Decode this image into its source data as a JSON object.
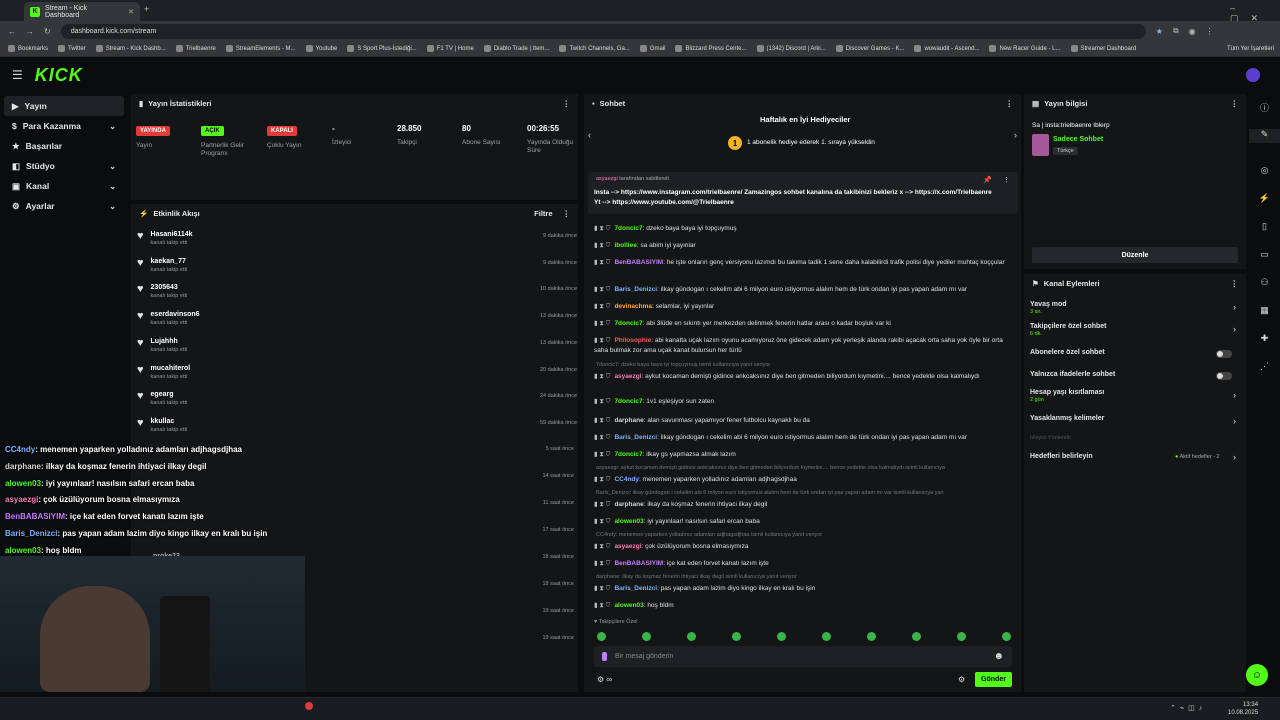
{
  "browser": {
    "tab_title": "Stream - Kick Dashboard",
    "url": "dashboard.kick.com/stream",
    "bookmarks": [
      "Bookmarks",
      "Twitter",
      "Stream - Kick Dashb...",
      "Trielbaenre",
      "StreamElements - M...",
      "Youtube",
      "S Sport Plus-İstediği...",
      "F1 TV | Home",
      "Diablo Trade | Item...",
      "Twitch Channels, Ga...",
      "Gmail",
      "Blizzard Press Cente...",
      "(1342) Discord | Arki...",
      "Discover Games - K...",
      "wowaudit - Ascend...",
      "New Racer Guide - L...",
      "Streamer Dashboard"
    ],
    "all_bookmarks": "Tüm Yer İşaretleri"
  },
  "brand": {
    "logo": "KICK"
  },
  "sidebar": {
    "items": [
      {
        "label": "Yayın"
      },
      {
        "label": "Para Kazanma"
      },
      {
        "label": "Başarılar"
      },
      {
        "label": "Stüdyo"
      },
      {
        "label": "Kanal"
      },
      {
        "label": "Ayarlar"
      }
    ]
  },
  "stats": {
    "title": "Yayın İstatistikleri",
    "cells": [
      {
        "badge": "YAYINDA",
        "label": "Yayın"
      },
      {
        "badge": "AÇIK",
        "label": "Partnerlik Gelir Programı"
      },
      {
        "badge": "KAPALI",
        "label": "Çoklu Yayın"
      },
      {
        "value": "-",
        "label": "İzleyici"
      },
      {
        "value": "28.850",
        "label": "Takipçi"
      },
      {
        "value": "80",
        "label": "Abone Sayısı"
      },
      {
        "value": "00:26:55",
        "label": "Yayında Olduğu Süre"
      }
    ]
  },
  "activity": {
    "title": "Etkinlik Akışı",
    "filter": "Filtre",
    "items": [
      {
        "name": "Hasani6114k",
        "sub": "kanalı takip etti",
        "time": "9 dakika önce"
      },
      {
        "name": "kaekan_77",
        "sub": "kanalı takip etti",
        "time": "9 dakika önce"
      },
      {
        "name": "2305643",
        "sub": "kanalı takip etti",
        "time": "10 dakika önce"
      },
      {
        "name": "eserdavinson6",
        "sub": "kanalı takip etti",
        "time": "13 dakika önce"
      },
      {
        "name": "Lujahhh",
        "sub": "kanalı takip etti",
        "time": "13 dakika önce"
      },
      {
        "name": "mucahiterol",
        "sub": "kanalı takip etti",
        "time": "20 dakika önce"
      },
      {
        "name": "egearg",
        "sub": "kanalı takip etti",
        "time": "24 dakika önce"
      },
      {
        "name": "kkullac",
        "sub": "kanalı takip etti",
        "time": "59 dakika önce"
      }
    ],
    "times_more": [
      "5 saat önce",
      "14 saat önce",
      "11 saat önce",
      "17 saat önce",
      "18 saat önce",
      "18 saat önce",
      "19 saat önce",
      "19 saat önce"
    ],
    "partial_name": "proke23"
  },
  "overlay_chat": [
    {
      "user": "CC4ndy",
      "color": "#7fb2ff",
      "text": ": menemen yaparken yolladınız adamları adjhagsdjhaa"
    },
    {
      "user": "darphane",
      "color": "#d5d5d5",
      "text": ": ilkay da koşmaz fenerin ihtiyaci ilkay degil"
    },
    {
      "user": "alowen03",
      "color": "#53fc18",
      "text": ": iyi yayınlaar! nasılsın safari ercan baba"
    },
    {
      "user": "asyaezgi",
      "color": "#ff7eb6",
      "text": ": çok üzülüyorum bosna elmasıymıza"
    },
    {
      "user": "BenBABASIYIM",
      "color": "#c67cff",
      "text": ": içe kat eden forvet kanatı lazım işte"
    },
    {
      "user": "Baris_Denizci",
      "color": "#7fb2ff",
      "text": ": pas yapan adam lazim diyo kingo ilkay en kralı bu işin"
    },
    {
      "user": "alowen03",
      "color": "#53fc18",
      "text": ": hoş bldm"
    }
  ],
  "chat": {
    "title": "Sohbet",
    "gift_title": "Haftalık en İyi Hediyeciler",
    "gift_rank": "1",
    "gift_text": "1 abonelik hediye ederek 1. sıraya yükseldin",
    "pinned_by": "asyaezgi",
    "pinned_by_suffix": "tarafından sabitlendi",
    "pinned_text": "Insta --> https://www.instagram.com/trielbaenre/ Zamazingos sohbet kanalına da takibinizi bekleriz x --> https://x.com/Trielbaenre Yt --> https://www.youtube.com/@Trielbaenre",
    "messages": [
      {
        "user": "7doncic7",
        "color": "#53fc18",
        "text": ": dzeko baya baya iyi topçuymuş"
      },
      {
        "user": "ibolliee",
        "color": "#53fc18",
        "text": ": sa abim iyi yayınlar"
      },
      {
        "user": "BenBABASIYIM",
        "color": "#c67cff",
        "text": ": he işte onların genç versiyonu lazımdı bu takıma tadik 1 sene daha kalabilirdi trafik polisi diye yediler muhtaç koççular"
      },
      {
        "user": "Baris_Denizci",
        "color": "#7fb2ff",
        "text": ": ilkay gündogan ı cekelim abi 6 milyon euro istiyormus alalım hem de türk ondan iyi pas yapan adam mı var"
      },
      {
        "user": "devinachma",
        "color": "#ffb02e",
        "text": ": selamlar, iyi yayınlar"
      },
      {
        "user": "7doncic7",
        "color": "#53fc18",
        "text": ": abi 3lüde en sıkıntı yer merkezden delinmek fenerin hatlar arası o kadar boşluk var ki"
      },
      {
        "user": "Philosophie",
        "color": "#ff5c5c",
        "text": ": abi kanatta uçak lazım oyunu acamıyoruz öne gidecek adam yok yerleşik alanda rakibi açacak orta saha yok öyle bir orta saha bulmak zor ama uçak kanat bulursun her türlü"
      },
      {
        "user": "asyaezgi",
        "color": "#ff7eb6",
        "text": ": aykut kocaman demişti gidince ankcaksınız diye ben gitmeden biliyordum kıymetini.... bence yedekte olsa kalmalıydı"
      },
      {
        "user": "7doncic7",
        "color": "#53fc18",
        "text": ": 1v1 eşleşiyor sun zaten"
      },
      {
        "user": "darphane",
        "color": "#d5d5d5",
        "text": ": alan savunması yapamıyor fener futbolcu kaynaklı bu da"
      },
      {
        "user": "Baris_Denizci",
        "color": "#7fb2ff",
        "text": ": ilkay gündogan ı cekelim abi 6 milyon euro istiyormus alalım hem de türk ondan iyi pas yapan adam mı var"
      },
      {
        "user": "7doncic7",
        "color": "#53fc18",
        "text": ": ilkay gs yapmazsa almak lazım"
      },
      {
        "user": "CC4ndy",
        "color": "#7fb2ff",
        "text": ": menemen yaparken yolladınız adamları adjhagsdjhaa"
      },
      {
        "user": "darphane",
        "color": "#d5d5d5",
        "text": ": ilkay da koşmaz fenerin ihtiyaci ilkay degil"
      },
      {
        "user": "alowen03",
        "color": "#53fc18",
        "text": ": iyi yayınlaar! nasılsın safari ercan baba"
      },
      {
        "user": "asyaezgi",
        "color": "#ff7eb6",
        "text": ": çok üzülüyorum bosna elmasıymıza"
      },
      {
        "user": "BenBABASIYIM",
        "color": "#c67cff",
        "text": ": içe kat eden forvet kanatı lazım işte"
      },
      {
        "user": "Baris_Denizci",
        "color": "#7fb2ff",
        "text": ": pas yapan adam lazim diyo kingo ilkay en kralı bu işin"
      },
      {
        "user": "alowen03",
        "color": "#53fc18",
        "text": ": hoş bldm"
      }
    ],
    "replies": [
      "7doncic7: dzeko baya baya iyi topçuymuş isimli kullanıcıya yanıt veriyor",
      "asyaezgi: aykut kocaman demişti gidince ankcaksınız diye ben gitmeden biliyordum kıymetini.... bence yedekte olsa kalmalıydı isimli kullanıcıya",
      "Baris_Denizci: ilkay gündogan ı cekelim abi 6 milyon euro istiyormus alalım hem de türk ondan iyi pas yapan adam mı var isimli kullanıcıya yan",
      "CC4ndy: menemen yaparken yolladınız adamları adjhagsdjhaa isimli kullanıcıya yanıt veriyor",
      "darphane: ilkay da koşmaz fenerin ihtiyaci ilkay degil isimli kullanıcıya yanıt veriyor"
    ],
    "emote_label": "Takipçilere Özel",
    "input_placeholder": "Bir mesaj gönderin",
    "send_label": "Gönder"
  },
  "stream_info": {
    "title": "Yayın bilgisi",
    "stream_title": "Sa | insta:trielbaenre Iblerp",
    "category": "Sadece Sohbet",
    "language": "Türkçe",
    "edit_label": "Düzenle"
  },
  "channel_actions": {
    "title": "Kanal Eylemleri",
    "items": [
      {
        "label": "Yavaş mod",
        "sub": "3 sn."
      },
      {
        "label": "Takipçilere özel sohbet",
        "sub": "6 dk."
      },
      {
        "label": "Abonelere özel sohbet",
        "sub": ""
      },
      {
        "label": "Yalnızca ifadelerle sohbet",
        "sub": ""
      },
      {
        "label": "Hesap yaşı kısıtlaması",
        "sub": "2 gün"
      },
      {
        "label": "Yasaklanmış kelimeler",
        "sub": ""
      }
    ],
    "disabled_label": "İzleyici Yönlendir",
    "goals_label": "Hedefleri belirleyin",
    "goals_status": "Aktif hedefler - 2"
  },
  "taskbar": {
    "time": "13:34",
    "date": "10.08.2025"
  }
}
